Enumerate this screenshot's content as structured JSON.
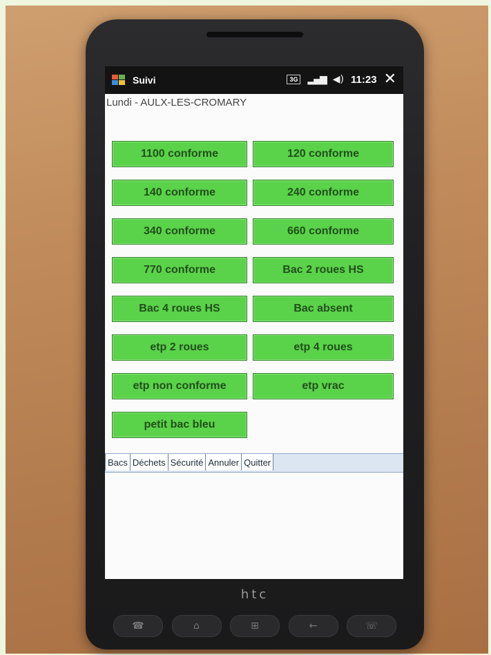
{
  "window": {
    "app_title": "Suivi",
    "status_3g": "3G",
    "time": "11:23",
    "close": "✕"
  },
  "subtitle": "Lundi - AULX-LES-CROMARY",
  "buttons": [
    "1100 conforme",
    "120 conforme",
    "140 conforme",
    "240 conforme",
    "340 conforme",
    "660 conforme",
    "770 conforme",
    "Bac 2 roues HS",
    "Bac 4 roues HS",
    "Bac absent",
    "etp 2 roues",
    "etp 4 roues",
    "etp non conforme",
    "etp vrac",
    "petit bac bleu"
  ],
  "tabs": [
    "Bacs",
    "Déchets",
    "Sécurité",
    "Annuler",
    "Quitter"
  ],
  "device": {
    "brand": "htc"
  },
  "colors": {
    "button": "#5ad24a",
    "titlebar": "#131313",
    "tabbar": "#dce6f2"
  }
}
